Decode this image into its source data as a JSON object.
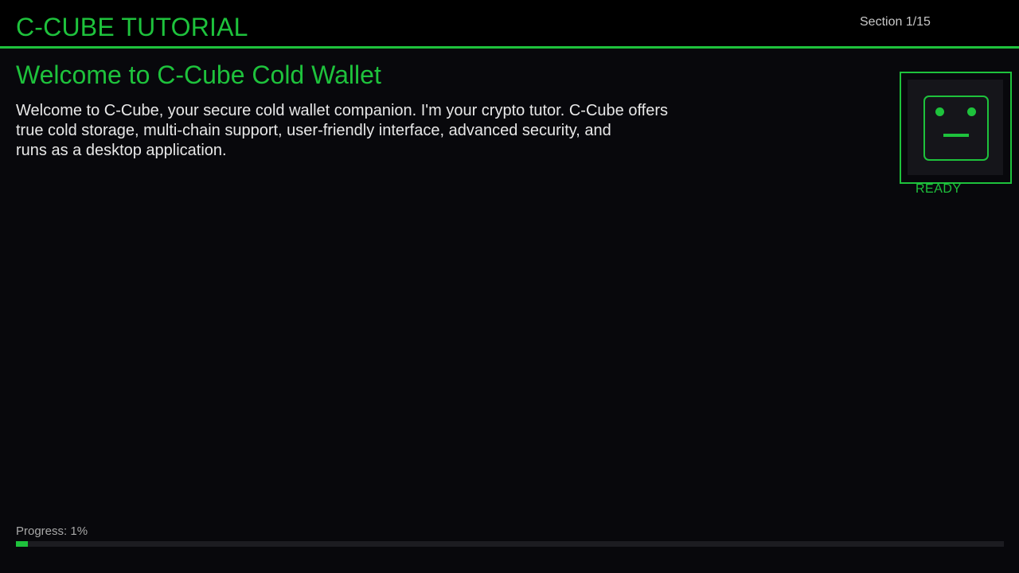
{
  "header": {
    "title": "C-CUBE TUTORIAL",
    "section_label": "Section 1/15"
  },
  "content": {
    "title": "Welcome to C-Cube Cold Wallet",
    "body_lines": [
      "Welcome to C-Cube, your secure cold wallet companion. I'm your crypto tutor. C-Cube offers",
      "true cold storage, multi-chain support, user-friendly interface, advanced security, and",
      "runs as a desktop application."
    ]
  },
  "avatar": {
    "icon": "robot-face-icon",
    "status": "READY"
  },
  "progress": {
    "label": "Progress: 1%",
    "value_percent": 1
  },
  "colors": {
    "accent": "#1ec23c",
    "background": "#08080c",
    "header_background": "#000000",
    "text": "#e8e8e8",
    "muted_text": "#a8a8a8",
    "track": "#1c1c21"
  }
}
